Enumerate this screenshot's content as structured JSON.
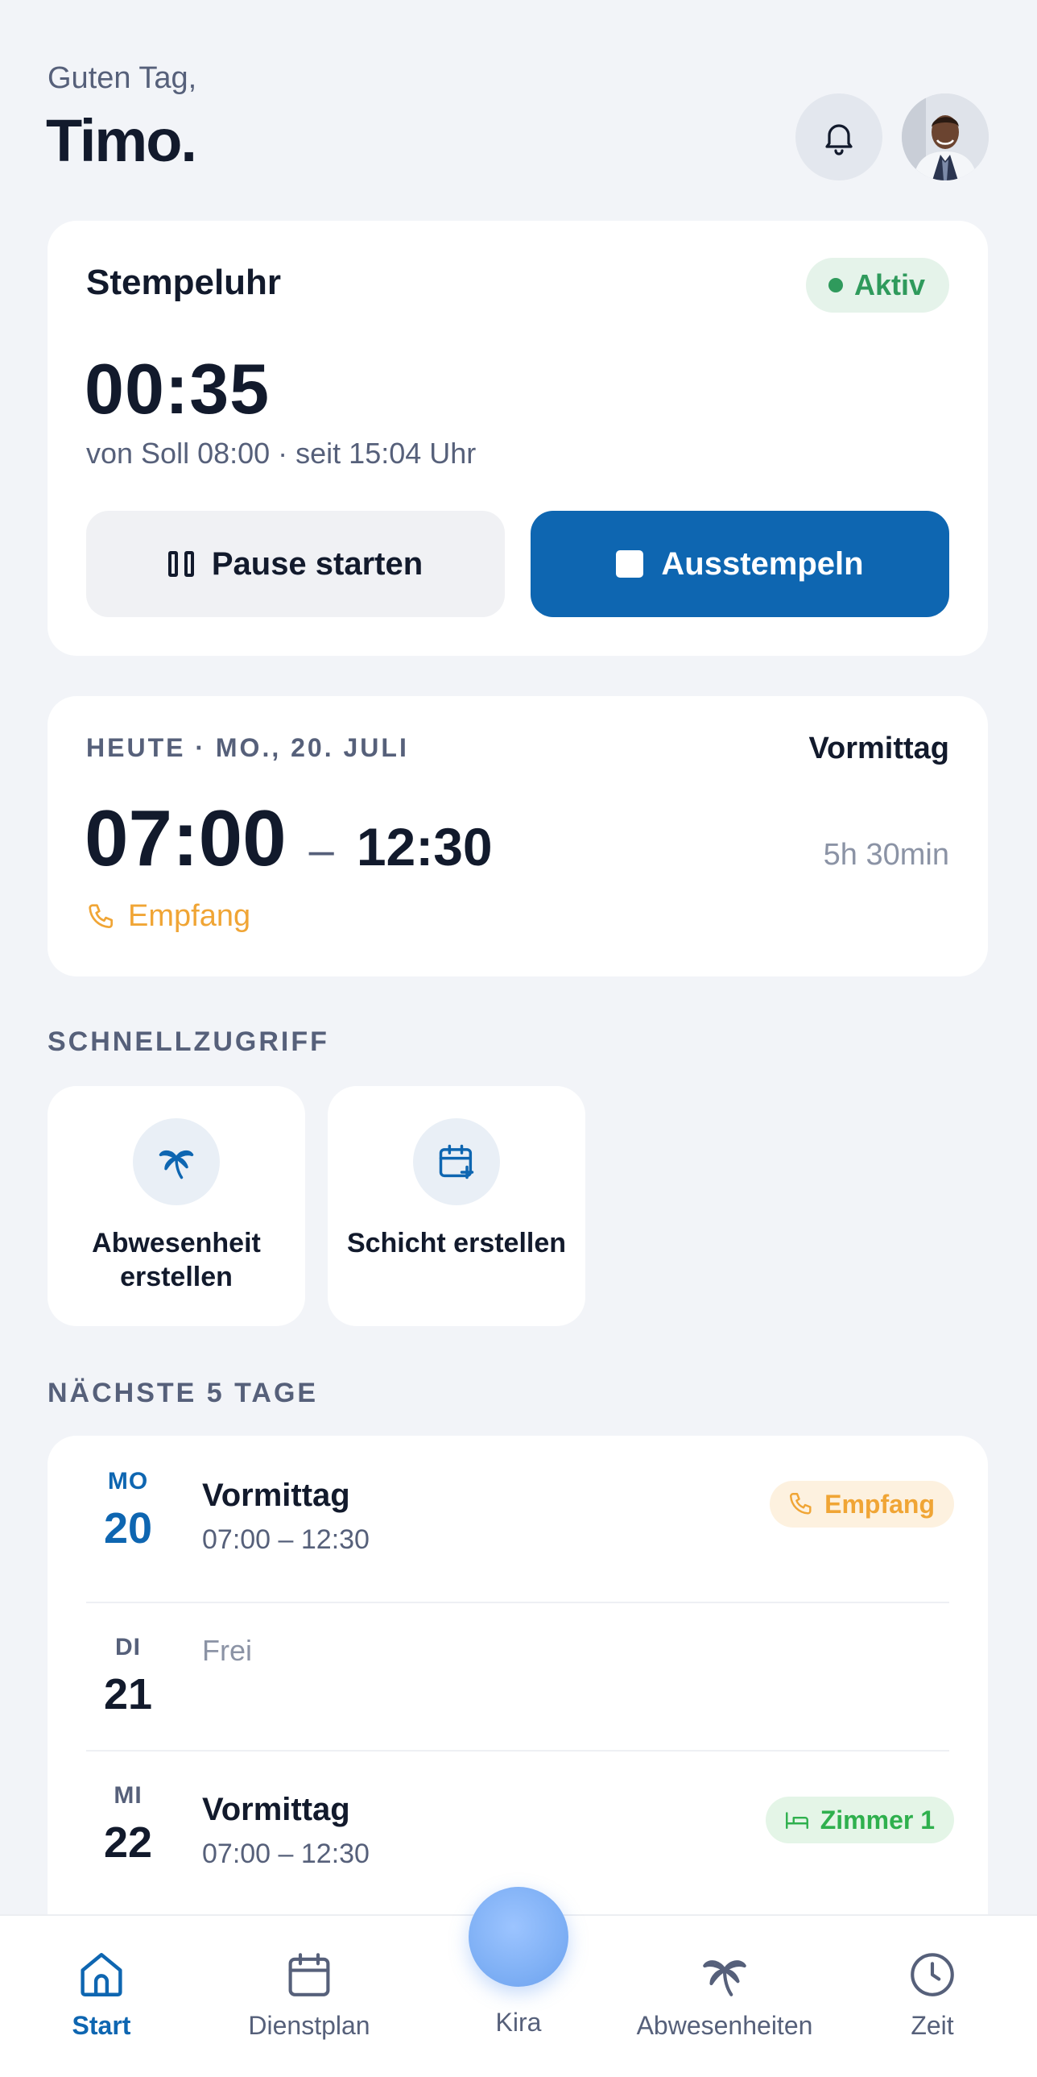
{
  "header": {
    "greeting": "Guten Tag,",
    "username": "Timo."
  },
  "clock": {
    "title": "Stempeluhr",
    "status": "Aktiv",
    "status_color": "#2f9a5c",
    "elapsed": "00:35",
    "subtitle": "von Soll 08:00 · seit 15:04 Uhr",
    "pause_label": "Pause starten",
    "clockout_label": "Ausstempeln",
    "accent": "#0e66b1"
  },
  "today": {
    "label": "HEUTE · MO., 20. JULI",
    "shift": "Vormittag",
    "start": "07:00",
    "dash": "–",
    "end": "12:30",
    "duration": "5h 30min",
    "location": "Empfang"
  },
  "quick_access": {
    "title": "SCHNELLZUGRIFF",
    "items": [
      {
        "label": "Abwesenheit erstellen",
        "icon": "palm-tree-icon"
      },
      {
        "label": "Schicht erstellen",
        "icon": "calendar-plus-icon"
      }
    ]
  },
  "next_days": {
    "title": "NÄCHSTE 5 TAGE",
    "days": [
      {
        "abbr": "MO",
        "num": "20",
        "shift": "Vormittag",
        "time": "07:00 – 12:30",
        "tag": "Empfang",
        "tag_icon": "phone-icon"
      },
      {
        "abbr": "DI",
        "num": "21",
        "free": "Frei"
      },
      {
        "abbr": "MI",
        "num": "22",
        "shift": "Vormittag",
        "time": "07:00 – 12:30",
        "tag": "Zimmer 1",
        "tag_icon": "bed-icon"
      }
    ]
  },
  "nav": {
    "items": [
      {
        "label": "Start",
        "icon": "home-icon",
        "active": true
      },
      {
        "label": "Dienstplan",
        "icon": "calendar-icon"
      },
      {
        "label": "Kira",
        "icon": "kira-orb"
      },
      {
        "label": "Abwesenheiten",
        "icon": "palm-tree-icon"
      },
      {
        "label": "Zeit",
        "icon": "clock-icon"
      }
    ]
  }
}
